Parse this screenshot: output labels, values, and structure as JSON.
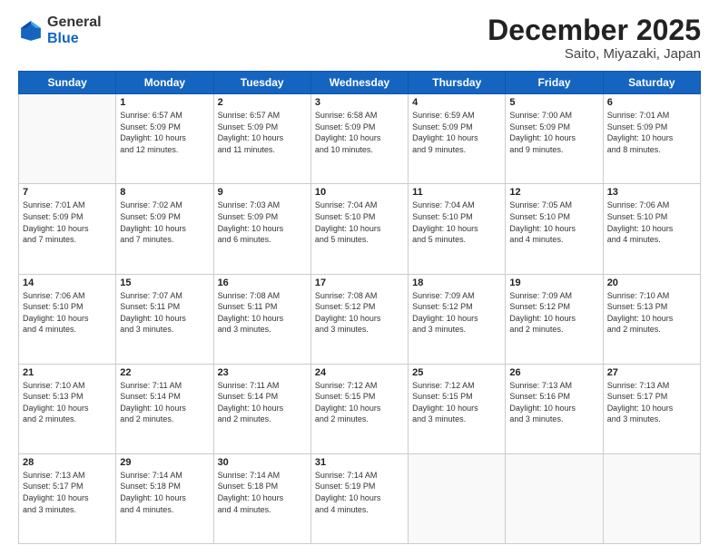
{
  "header": {
    "logo_line1": "General",
    "logo_line2": "Blue",
    "month": "December 2025",
    "location": "Saito, Miyazaki, Japan"
  },
  "days_of_week": [
    "Sunday",
    "Monday",
    "Tuesday",
    "Wednesday",
    "Thursday",
    "Friday",
    "Saturday"
  ],
  "weeks": [
    [
      {
        "day": "",
        "info": ""
      },
      {
        "day": "1",
        "info": "Sunrise: 6:57 AM\nSunset: 5:09 PM\nDaylight: 10 hours\nand 12 minutes."
      },
      {
        "day": "2",
        "info": "Sunrise: 6:57 AM\nSunset: 5:09 PM\nDaylight: 10 hours\nand 11 minutes."
      },
      {
        "day": "3",
        "info": "Sunrise: 6:58 AM\nSunset: 5:09 PM\nDaylight: 10 hours\nand 10 minutes."
      },
      {
        "day": "4",
        "info": "Sunrise: 6:59 AM\nSunset: 5:09 PM\nDaylight: 10 hours\nand 9 minutes."
      },
      {
        "day": "5",
        "info": "Sunrise: 7:00 AM\nSunset: 5:09 PM\nDaylight: 10 hours\nand 9 minutes."
      },
      {
        "day": "6",
        "info": "Sunrise: 7:01 AM\nSunset: 5:09 PM\nDaylight: 10 hours\nand 8 minutes."
      }
    ],
    [
      {
        "day": "7",
        "info": "Sunrise: 7:01 AM\nSunset: 5:09 PM\nDaylight: 10 hours\nand 7 minutes."
      },
      {
        "day": "8",
        "info": "Sunrise: 7:02 AM\nSunset: 5:09 PM\nDaylight: 10 hours\nand 7 minutes."
      },
      {
        "day": "9",
        "info": "Sunrise: 7:03 AM\nSunset: 5:09 PM\nDaylight: 10 hours\nand 6 minutes."
      },
      {
        "day": "10",
        "info": "Sunrise: 7:04 AM\nSunset: 5:10 PM\nDaylight: 10 hours\nand 5 minutes."
      },
      {
        "day": "11",
        "info": "Sunrise: 7:04 AM\nSunset: 5:10 PM\nDaylight: 10 hours\nand 5 minutes."
      },
      {
        "day": "12",
        "info": "Sunrise: 7:05 AM\nSunset: 5:10 PM\nDaylight: 10 hours\nand 4 minutes."
      },
      {
        "day": "13",
        "info": "Sunrise: 7:06 AM\nSunset: 5:10 PM\nDaylight: 10 hours\nand 4 minutes."
      }
    ],
    [
      {
        "day": "14",
        "info": "Sunrise: 7:06 AM\nSunset: 5:10 PM\nDaylight: 10 hours\nand 4 minutes."
      },
      {
        "day": "15",
        "info": "Sunrise: 7:07 AM\nSunset: 5:11 PM\nDaylight: 10 hours\nand 3 minutes."
      },
      {
        "day": "16",
        "info": "Sunrise: 7:08 AM\nSunset: 5:11 PM\nDaylight: 10 hours\nand 3 minutes."
      },
      {
        "day": "17",
        "info": "Sunrise: 7:08 AM\nSunset: 5:12 PM\nDaylight: 10 hours\nand 3 minutes."
      },
      {
        "day": "18",
        "info": "Sunrise: 7:09 AM\nSunset: 5:12 PM\nDaylight: 10 hours\nand 3 minutes."
      },
      {
        "day": "19",
        "info": "Sunrise: 7:09 AM\nSunset: 5:12 PM\nDaylight: 10 hours\nand 2 minutes."
      },
      {
        "day": "20",
        "info": "Sunrise: 7:10 AM\nSunset: 5:13 PM\nDaylight: 10 hours\nand 2 minutes."
      }
    ],
    [
      {
        "day": "21",
        "info": "Sunrise: 7:10 AM\nSunset: 5:13 PM\nDaylight: 10 hours\nand 2 minutes."
      },
      {
        "day": "22",
        "info": "Sunrise: 7:11 AM\nSunset: 5:14 PM\nDaylight: 10 hours\nand 2 minutes."
      },
      {
        "day": "23",
        "info": "Sunrise: 7:11 AM\nSunset: 5:14 PM\nDaylight: 10 hours\nand 2 minutes."
      },
      {
        "day": "24",
        "info": "Sunrise: 7:12 AM\nSunset: 5:15 PM\nDaylight: 10 hours\nand 2 minutes."
      },
      {
        "day": "25",
        "info": "Sunrise: 7:12 AM\nSunset: 5:15 PM\nDaylight: 10 hours\nand 3 minutes."
      },
      {
        "day": "26",
        "info": "Sunrise: 7:13 AM\nSunset: 5:16 PM\nDaylight: 10 hours\nand 3 minutes."
      },
      {
        "day": "27",
        "info": "Sunrise: 7:13 AM\nSunset: 5:17 PM\nDaylight: 10 hours\nand 3 minutes."
      }
    ],
    [
      {
        "day": "28",
        "info": "Sunrise: 7:13 AM\nSunset: 5:17 PM\nDaylight: 10 hours\nand 3 minutes."
      },
      {
        "day": "29",
        "info": "Sunrise: 7:14 AM\nSunset: 5:18 PM\nDaylight: 10 hours\nand 4 minutes."
      },
      {
        "day": "30",
        "info": "Sunrise: 7:14 AM\nSunset: 5:18 PM\nDaylight: 10 hours\nand 4 minutes."
      },
      {
        "day": "31",
        "info": "Sunrise: 7:14 AM\nSunset: 5:19 PM\nDaylight: 10 hours\nand 4 minutes."
      },
      {
        "day": "",
        "info": ""
      },
      {
        "day": "",
        "info": ""
      },
      {
        "day": "",
        "info": ""
      }
    ]
  ]
}
